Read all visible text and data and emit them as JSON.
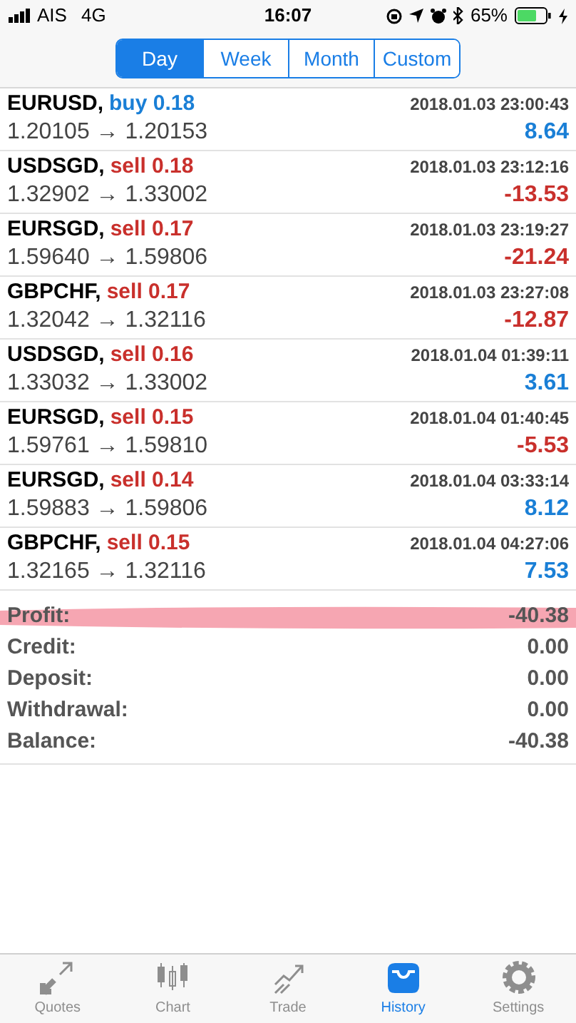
{
  "status_bar": {
    "carrier": "AIS",
    "network": "4G",
    "time": "16:07",
    "battery_percent": "65%"
  },
  "period_tabs": [
    {
      "label": "Day",
      "selected": true
    },
    {
      "label": "Week",
      "selected": false
    },
    {
      "label": "Month",
      "selected": false
    },
    {
      "label": "Custom",
      "selected": false
    }
  ],
  "trades": [
    {
      "symbol": "EURUSD,",
      "buy": true,
      "order": "buy 0.18",
      "time": "2018.01.03 23:00:43",
      "prices": "1.20105 → 1.20153",
      "profit": "8.64",
      "gain": true
    },
    {
      "symbol": "USDSGD,",
      "buy": false,
      "order": "sell 0.18",
      "time": "2018.01.03 23:12:16",
      "prices": "1.32902 → 1.33002",
      "profit": "-13.53",
      "gain": false
    },
    {
      "symbol": "EURSGD,",
      "buy": false,
      "order": "sell 0.17",
      "time": "2018.01.03 23:19:27",
      "prices": "1.59640 → 1.59806",
      "profit": "-21.24",
      "gain": false
    },
    {
      "symbol": "GBPCHF,",
      "buy": false,
      "order": "sell 0.17",
      "time": "2018.01.03 23:27:08",
      "prices": "1.32042 → 1.32116",
      "profit": "-12.87",
      "gain": false
    },
    {
      "symbol": "USDSGD,",
      "buy": false,
      "order": "sell 0.16",
      "time": "2018.01.04 01:39:11",
      "prices": "1.33032 → 1.33002",
      "profit": "3.61",
      "gain": true
    },
    {
      "symbol": "EURSGD,",
      "buy": false,
      "order": "sell 0.15",
      "time": "2018.01.04 01:40:45",
      "prices": "1.59761 → 1.59810",
      "profit": "-5.53",
      "gain": false
    },
    {
      "symbol": "EURSGD,",
      "buy": false,
      "order": "sell 0.14",
      "time": "2018.01.04 03:33:14",
      "prices": "1.59883 → 1.59806",
      "profit": "8.12",
      "gain": true
    },
    {
      "symbol": "GBPCHF,",
      "buy": false,
      "order": "sell 0.15",
      "time": "2018.01.04 04:27:06",
      "prices": "1.32165 → 1.32116",
      "profit": "7.53",
      "gain": true
    }
  ],
  "summary": [
    {
      "label": "Profit:",
      "value": "-40.38",
      "highlighted": true
    },
    {
      "label": "Credit:",
      "value": "0.00",
      "highlighted": false
    },
    {
      "label": "Deposit:",
      "value": "0.00",
      "highlighted": false
    },
    {
      "label": "Withdrawal:",
      "value": "0.00",
      "highlighted": false
    },
    {
      "label": "Balance:",
      "value": "-40.38",
      "highlighted": false
    }
  ],
  "tab_bar": [
    {
      "kind": "quotes",
      "label": "Quotes",
      "selected": false
    },
    {
      "kind": "chart",
      "label": "Chart",
      "selected": false
    },
    {
      "kind": "trade",
      "label": "Trade",
      "selected": false
    },
    {
      "kind": "history",
      "label": "History",
      "selected": true
    },
    {
      "kind": "settings",
      "label": "Settings",
      "selected": false
    }
  ]
}
